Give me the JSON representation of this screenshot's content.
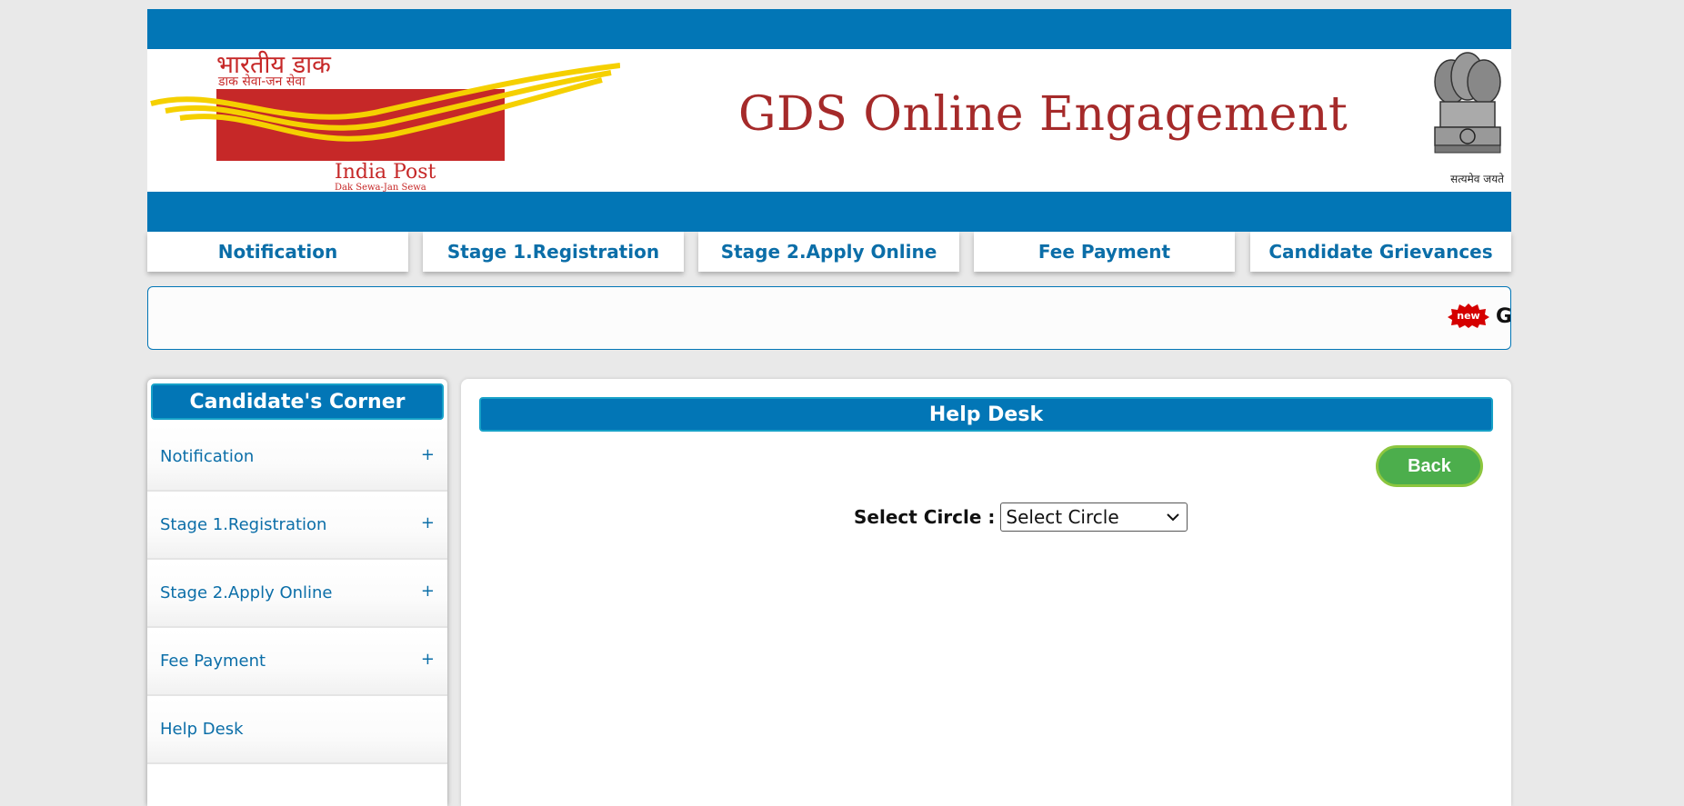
{
  "header": {
    "title": "GDS Online Engagement",
    "logo": {
      "hindi_text": "भारतीय डाक",
      "hindi_tagline": "डाक सेवा-जन सेवा",
      "name": "India Post",
      "tagline": "Dak Sewa-Jan Sewa"
    },
    "emblem": {
      "icon": "ashoka-emblem-icon",
      "caption": "सत्यमेव जयते"
    },
    "brand_colors": {
      "band": "#0276b6",
      "title": "#a52a2a",
      "logo_red": "#c62828",
      "logo_yellow": "#f5d000"
    }
  },
  "topnav": [
    {
      "label": "Notification"
    },
    {
      "label": "Stage 1.Registration"
    },
    {
      "label": "Stage 2.Apply Online"
    },
    {
      "label": "Fee Payment"
    },
    {
      "label": "Candidate Grievances"
    }
  ],
  "marquee": {
    "badge": "new",
    "text": "G"
  },
  "sidebar": {
    "title": "Candidate's Corner",
    "items": [
      {
        "label": "Notification",
        "expand": "+"
      },
      {
        "label": "Stage 1.Registration",
        "expand": "+"
      },
      {
        "label": "Stage 2.Apply Online",
        "expand": "+"
      },
      {
        "label": "Fee Payment",
        "expand": "+"
      },
      {
        "label": "Help Desk",
        "expand": ""
      }
    ]
  },
  "main": {
    "title": "Help Desk",
    "back_label": "Back",
    "select_label": "Select Circle :",
    "select_value": "Select Circle",
    "back_color": "#4cae4c"
  }
}
